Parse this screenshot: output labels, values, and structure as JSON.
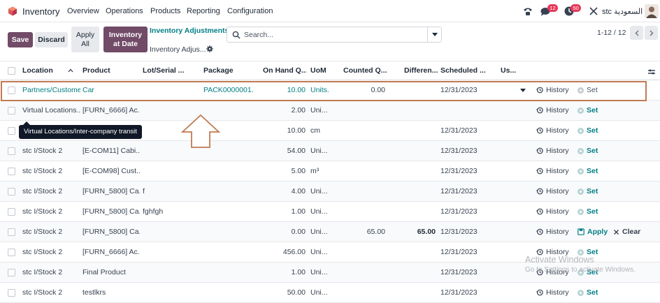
{
  "app": {
    "name": "Inventory"
  },
  "nav": {
    "menu": [
      "Overview",
      "Operations",
      "Products",
      "Reporting",
      "Configuration"
    ],
    "chat_badge": "12",
    "activity_badge": "50",
    "company": "stc السعودية"
  },
  "control": {
    "save": "Save",
    "discard": "Discard",
    "apply_all": [
      "Apply",
      "All"
    ],
    "inventory_at_date": [
      "Inventory",
      "at Date"
    ],
    "breadcrumb_parent": "Inventory Adjustments",
    "breadcrumb_current": "Inventory Adjus...",
    "search_placeholder": "Search...",
    "pager": "1-12 / 12"
  },
  "columns": {
    "location": "Location",
    "product": "Product",
    "lot": "Lot/Serial ...",
    "package": "Package",
    "onhand": "On Hand Q...",
    "uom": "UoM",
    "counted": "Counted Q...",
    "difference": "Differen...",
    "scheduled": "Scheduled ...",
    "user": "Us..."
  },
  "rows": [
    {
      "location": "Partners/Customers",
      "product": "Car",
      "lot": "",
      "package": "PACK0000001.",
      "onhand": "10.00",
      "uom": "Units.",
      "counted": "0.00",
      "difference": "",
      "scheduled": "12/31/2023",
      "user_dropdown": true,
      "history": "History",
      "set": "Set",
      "set_style": "grey",
      "editing": true
    },
    {
      "location": "Virtual Locations...",
      "product": "[FURN_6666] Ac...",
      "lot": "",
      "package": "",
      "onhand": "2.00",
      "uom": "Uni...",
      "counted": "",
      "difference": "",
      "scheduled": "",
      "history": "History",
      "set": "Set",
      "set_style": "teal"
    },
    {
      "location": "",
      "product": "",
      "lot": "",
      "package": "",
      "onhand": "10.00",
      "uom": "cm",
      "counted": "",
      "difference": "",
      "scheduled": "12/31/2023",
      "history": "History",
      "set": "Set",
      "set_style": "teal"
    },
    {
      "location": "stc I/Stock 2",
      "product": "[E-COM11] Cabi...",
      "lot": "",
      "package": "",
      "onhand": "54.00",
      "uom": "Uni...",
      "counted": "",
      "difference": "",
      "scheduled": "12/31/2023",
      "history": "History",
      "set": "Set",
      "set_style": "teal"
    },
    {
      "location": "stc I/Stock 2",
      "product": "[E-COM98] Cust...",
      "lot": "",
      "package": "",
      "onhand": "5.00",
      "uom": "m³",
      "counted": "",
      "difference": "",
      "scheduled": "12/31/2023",
      "history": "History",
      "set": "Set",
      "set_style": "teal"
    },
    {
      "location": "stc I/Stock 2",
      "product": "[FURN_5800] Ca...",
      "lot": "f",
      "package": "",
      "onhand": "4.00",
      "uom": "Uni...",
      "counted": "",
      "difference": "",
      "scheduled": "12/31/2023",
      "history": "History",
      "set": "Set",
      "set_style": "teal"
    },
    {
      "location": "stc I/Stock 2",
      "product": "[FURN_5800] Ca...",
      "lot": "fghfgh",
      "package": "",
      "onhand": "1.00",
      "uom": "Uni...",
      "counted": "",
      "difference": "",
      "scheduled": "12/31/2023",
      "history": "History",
      "set": "Set",
      "set_style": "teal"
    },
    {
      "location": "stc I/Stock 2",
      "product": "[FURN_5800] Ca...",
      "lot": "",
      "package": "",
      "onhand": "0.00",
      "uom": "Uni...",
      "counted": "65.00",
      "difference": "65.00",
      "scheduled": "12/31/2023",
      "history": "History",
      "apply": "Apply",
      "clear": "Clear"
    },
    {
      "location": "stc I/Stock 2",
      "product": "[FURN_6666] Ac...",
      "lot": "",
      "package": "",
      "onhand": "456.00",
      "uom": "Uni...",
      "counted": "",
      "difference": "",
      "scheduled": "12/31/2023",
      "history": "History",
      "set": "Set",
      "set_style": "teal"
    },
    {
      "location": "stc I/Stock 2",
      "product": "Final Product",
      "lot": "",
      "package": "",
      "onhand": "1.00",
      "uom": "Uni...",
      "counted": "",
      "difference": "",
      "scheduled": "12/31/2023",
      "history": "History",
      "set": "Set",
      "set_style": "teal"
    },
    {
      "location": "stc I/Stock 2",
      "product": "testlkrs",
      "lot": "",
      "package": "",
      "onhand": "50.00",
      "uom": "Uni...",
      "counted": "",
      "difference": "",
      "scheduled": "12/31/2023",
      "history": "History",
      "set": "Set",
      "set_style": "teal"
    }
  ],
  "tooltip": "Virtual Locations/Inter-company transit",
  "watermark": {
    "line1": "Activate Windows",
    "line2": "Go to Settings to activate Windows."
  },
  "colors": {
    "primary": "#714b67",
    "link": "#017e84",
    "highlight_frame": "#c07a52"
  }
}
